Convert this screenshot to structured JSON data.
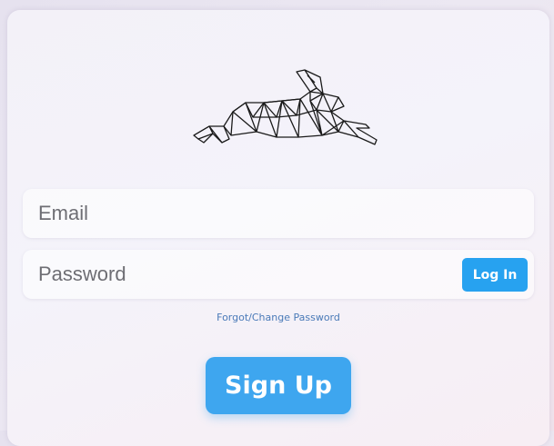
{
  "logo": {
    "icon": "geometric-rabbit-icon",
    "stroke_color": "#1a1a1a"
  },
  "email": {
    "value": "",
    "placeholder": "Email"
  },
  "password": {
    "value": "",
    "placeholder": "Password"
  },
  "login_button": {
    "label": "Log In",
    "color": "#27a2f0"
  },
  "forgot_link": {
    "label": "Forgot/Change Password"
  },
  "signup_button": {
    "label": "Sign Up",
    "color": "#3ea6ef"
  }
}
